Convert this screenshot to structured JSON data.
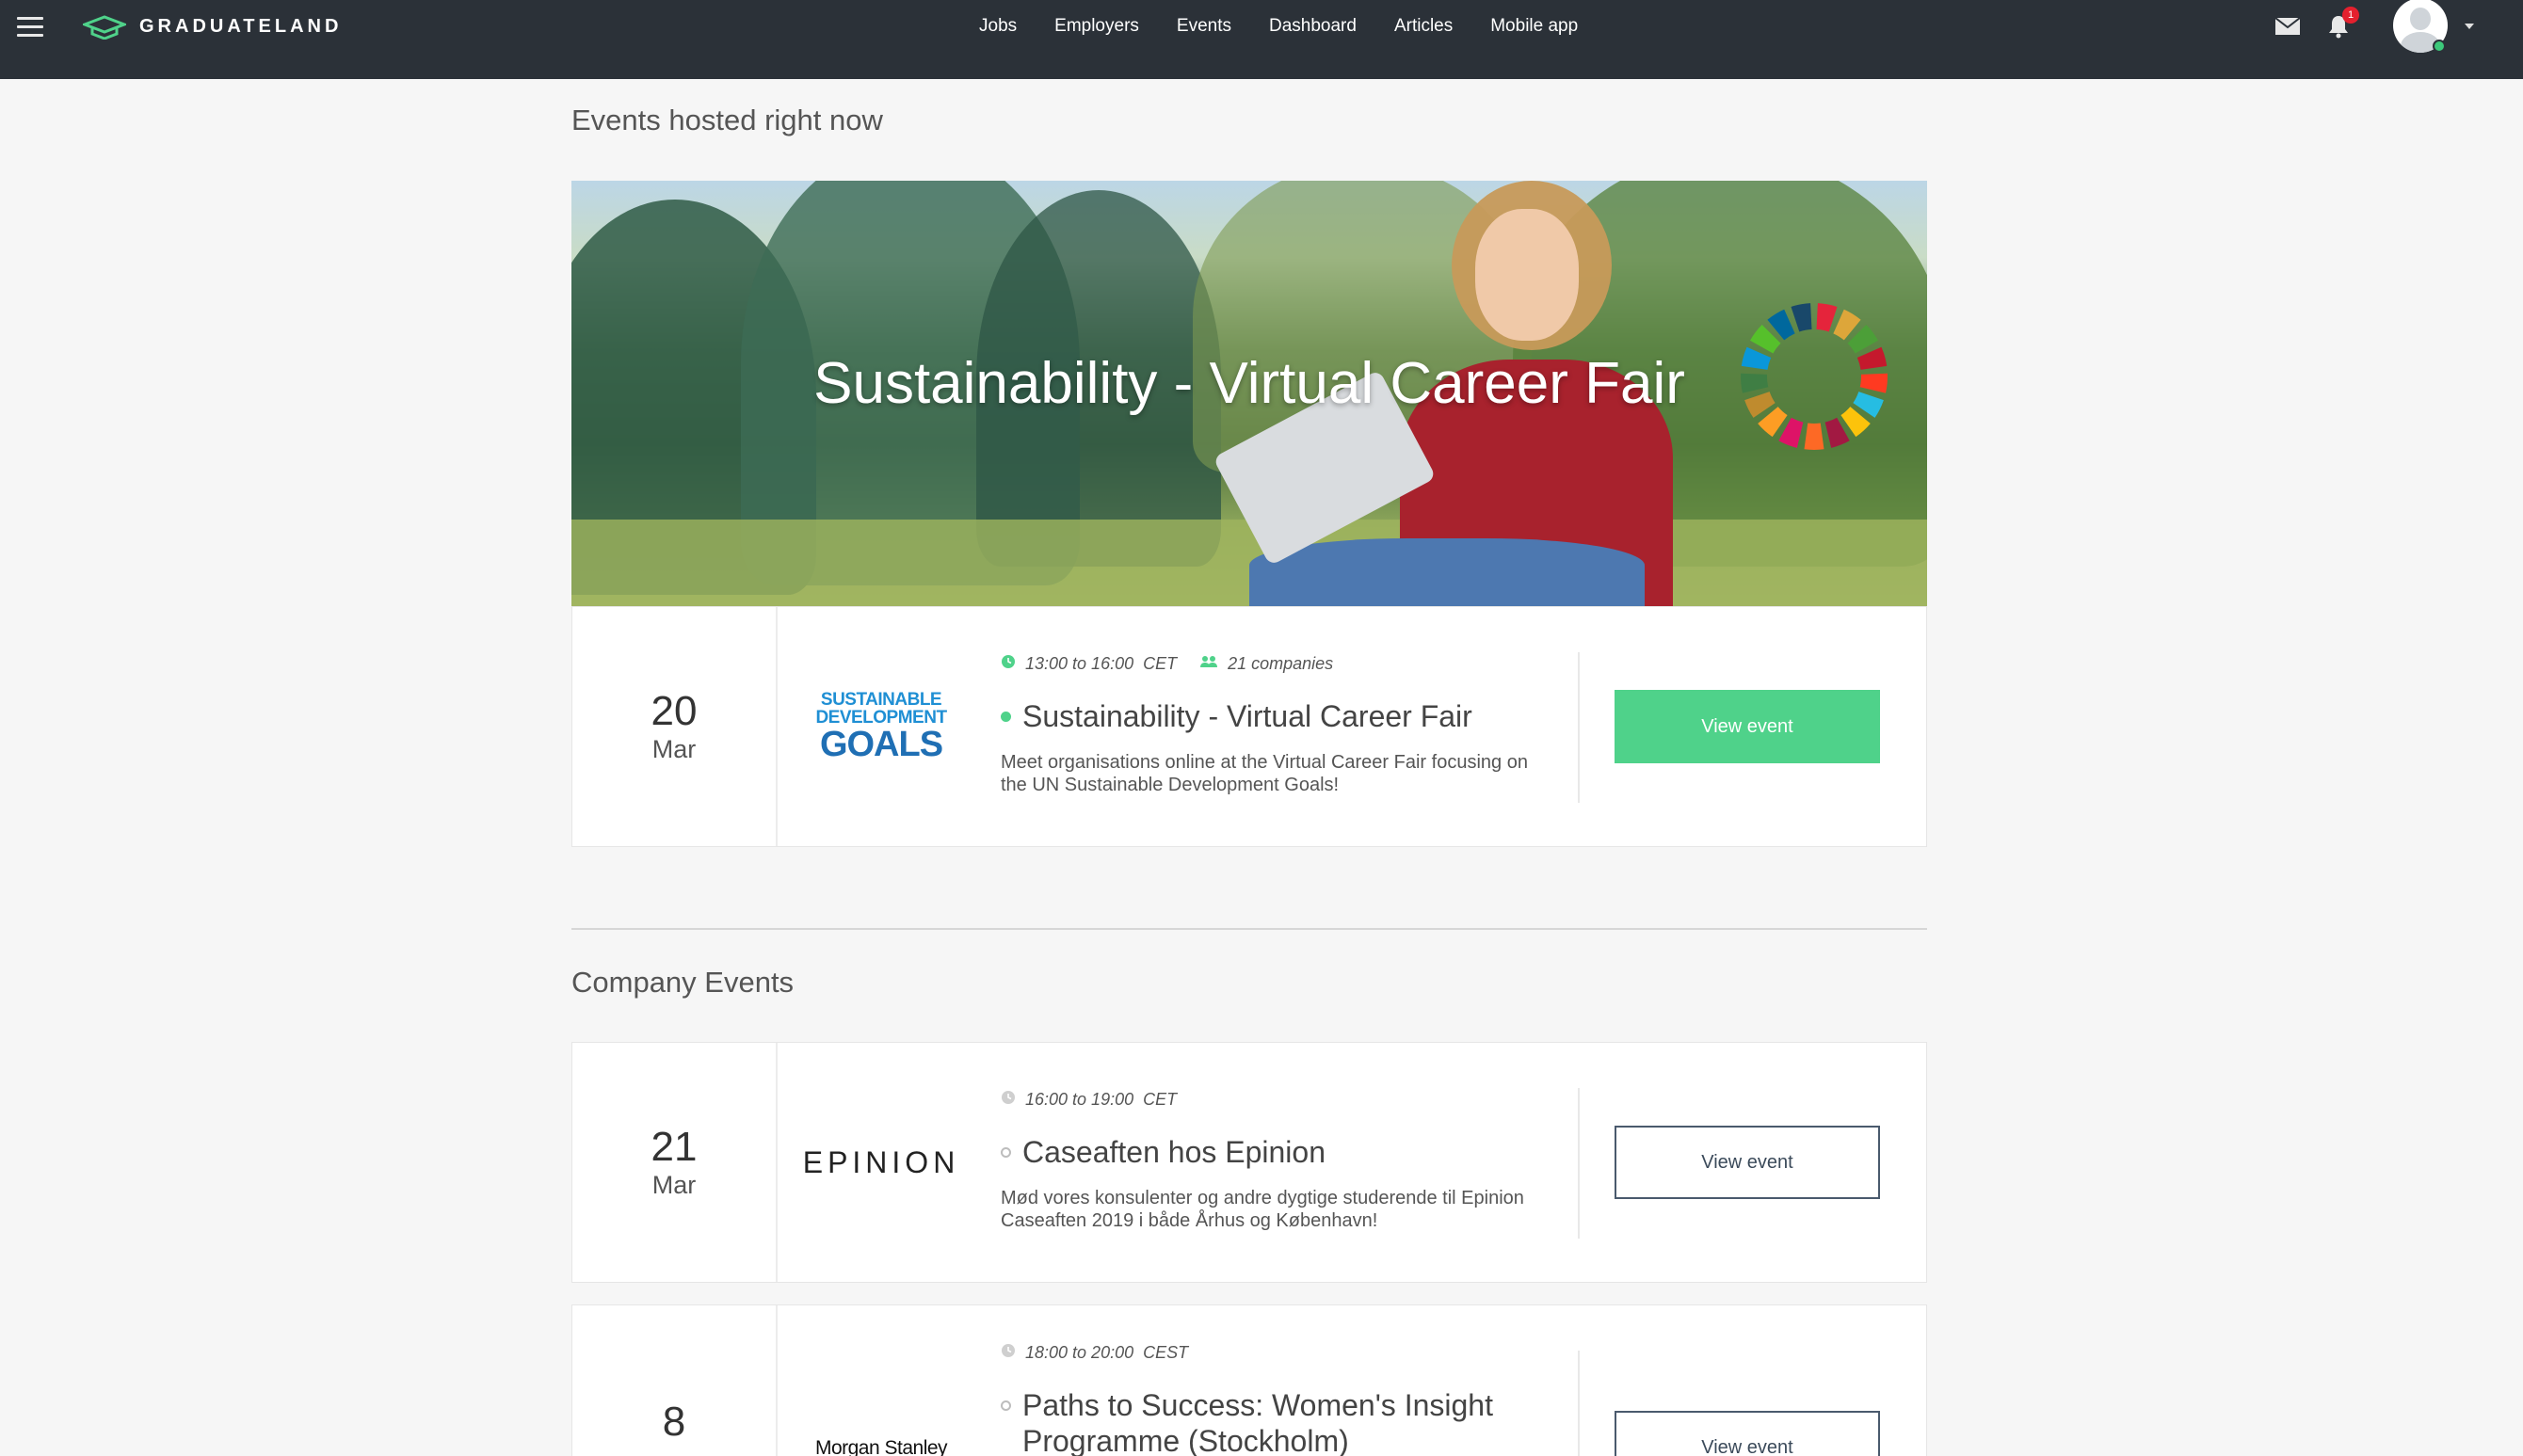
{
  "nav": {
    "brand": "GRADUATELAND",
    "links": [
      "Jobs",
      "Employers",
      "Events",
      "Dashboard",
      "Articles",
      "Mobile app"
    ],
    "notification_count": "1"
  },
  "sections": {
    "hosted_title": "Events hosted right now",
    "company_title": "Company Events"
  },
  "hero": {
    "title": "Sustainability - Virtual Career Fair"
  },
  "events": [
    {
      "day": "20",
      "month": "Mar",
      "logo_lines": [
        "SUSTAINABLE",
        "DEVELOPMENT",
        "GOALS"
      ],
      "time": "13:00 to 16:00",
      "timezone": "CET",
      "companies": "21 companies",
      "title": "Sustainability - Virtual Career Fair",
      "description": "Meet organisations online at the Virtual Career Fair focusing on the UN Sustainable Development Goals!",
      "button": "View event",
      "status_color": "#4fd28a",
      "button_style": "primary"
    },
    {
      "day": "21",
      "month": "Mar",
      "logo_text": "EPINION",
      "time": "16:00 to 19:00",
      "timezone": "CET",
      "title": "Caseaften hos Epinion",
      "description": "Mød vores konsulenter og andre dygtige studerende til Epinion Caseaften 2019 i både Århus og København!",
      "button": "View event",
      "button_style": "outline"
    },
    {
      "day": "8",
      "month": "",
      "logo_text": "Morgan Stanley",
      "time": "18:00 to 20:00",
      "timezone": "CEST",
      "title": "Paths to Success: Women's Insight Programme (Stockholm)",
      "button": "View event",
      "button_style": "outline"
    }
  ],
  "colors": {
    "navbar": "#2b3138",
    "accent_green": "#4fd28a",
    "notification_red": "#e4202e"
  }
}
